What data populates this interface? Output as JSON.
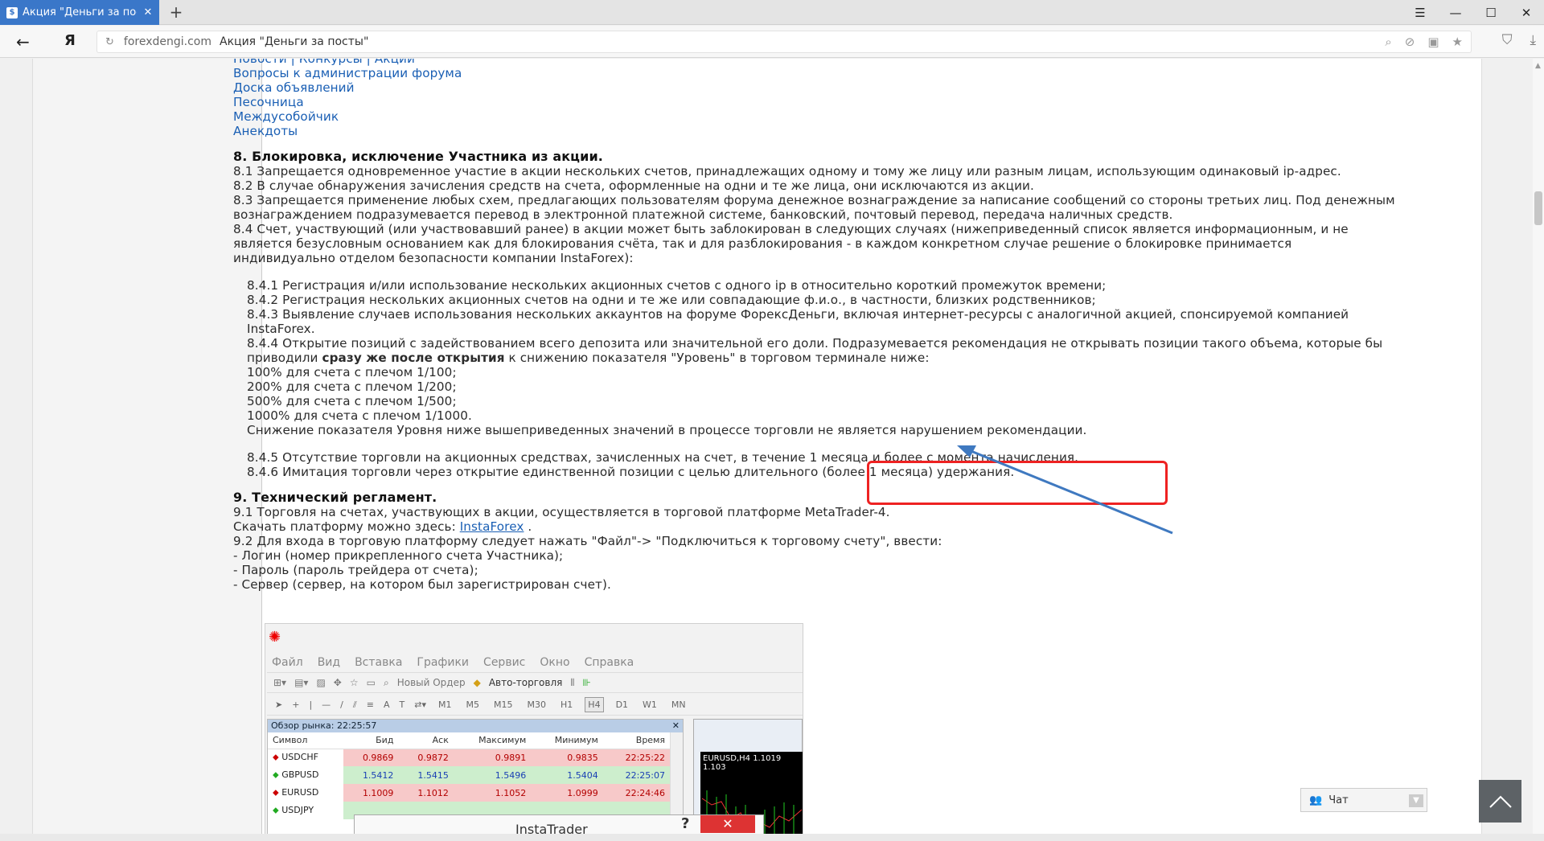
{
  "browser": {
    "tab_title": "Акция \"Деньги за посты\"",
    "tab_favicon": "forum-favicon",
    "new_tab": "+",
    "domain": "forexdengi.com",
    "page_title": "Акция \"Деньги за посты\"",
    "yandex_logo": "Я"
  },
  "content": {
    "links": [
      "Новости | Конкурсы | Акции",
      "Вопросы к администрации форума",
      "Доска объявлений",
      "Песочница",
      "Междусобойчик",
      "Анекдоты"
    ],
    "section8_title": "8. Блокировка, исключение Участника из акции.",
    "s8_1": "8.1 Запрещается одновременное участие в акции нескольких счетов, принадлежащих одному и тому же лицу или разным лицам, использующим одинаковый ip-адрес.",
    "s8_2": "8.2 В случае обнаружения зачисления средств на счета, оформленные на одни и те же лица, они исключаются из акции.",
    "s8_3a": "8.3 Запрещается применение любых схем, предлагающих пользователям форума денежное вознаграждение за написание сообщений со стороны третьих лиц. Под денежным",
    "s8_3b": "вознаграждением подразумевается перевод в электронной платежной системе, банковский, почтовый перевод, передача наличных средств.",
    "s8_4a": "8.4 Счет, участвующий (или участвовавший ранее) в акции может быть заблокирован в следующих случаях (нижеприведенный список является информационным, и не",
    "s8_4b": "является безусловным основанием как для блокирования счёта, так и для разблокирования - в каждом конкретном случае решение о блокировке принимается",
    "s8_4c": "индивидуально отделом безопасности компании InstaForex):",
    "s8_4_1": "8.4.1 Регистрация и/или использование нескольких акционных счетов с одного ip в относительно короткий промежуток времени;",
    "s8_4_2": "8.4.2 Регистрация нескольких акционных счетов на одни и те же или совпадающие ф.и.о., в частности, близких родственников;",
    "s8_4_3a": "8.4.3 Выявление случаев использования нескольких аккаунтов на форуме ФорексДеньги, включая интернет-ресурсы с аналогичной акцией, спонсируемой компанией",
    "s8_4_3b": "InstaForex.",
    "s8_4_4a": "8.4.4 Открытие позиций с задействованием всего депозита или значительной его доли. Подразумевается рекомендация не открывать позиции такого объема, которые бы",
    "s8_4_4b_pre": "приводили ",
    "s8_4_4b_bold": "сразу же после открытия",
    "s8_4_4b_post": " к снижению показателя \"Уровень\" в торговом терминале ниже:",
    "lev1": "100% для счета с плечом 1/100;",
    "lev2": "200% для счета с плечом 1/200;",
    "lev3": "500% для счета с плечом 1/500;",
    "lev4": "1000% для счета с плечом 1/1000.",
    "lev_note": "Снижение показателя Уровня ниже вышеприведенных значений в процессе торговли не является нарушением рекомендации.",
    "s8_4_5": "8.4.5 Отсутствие торговли на акционных средствах, зачисленных на счет, в течение 1 месяца и более с момента начисления.",
    "s8_4_6": "8.4.6 Имитация торговли через открытие единственной позиции с целью длительного (более 1 месяца) удержания.",
    "section9_title": "9. Технический регламент.",
    "s9_1": "9.1 Торговля на счетах, участвующих в акции, осуществляется в торговой платформе MetaTrader-4.",
    "s9_dl_pre": "Скачать платформу можно здесь: ",
    "s9_dl_link": "InstaForex",
    "s9_dl_post": " .",
    "s9_2": "9.2 Для входа в торговую платформу следует нажать \"Файл\"-> \"Подключиться к торговому счету\", ввести:",
    "s9_login": "- Логин (номер прикрепленного счета Участника);",
    "s9_pass": "- Пароль (пароль трейдера от счета);",
    "s9_server": "- Сервер (сервер, на котором был зарегистрирован счет)."
  },
  "mt4": {
    "menu": [
      "Файл",
      "Вид",
      "Вставка",
      "Графики",
      "Сервис",
      "Окно",
      "Справка"
    ],
    "new_order": "Новый Ордер",
    "auto_trading": "Авто-торговля",
    "timeframes": [
      "M1",
      "M5",
      "M15",
      "M30",
      "H1",
      "H4",
      "D1",
      "W1",
      "MN"
    ],
    "active_tf": "H4",
    "market_watch_title": "Обзор рынка: 22:25:57",
    "columns": [
      "Символ",
      "Бид",
      "Аск",
      "Максимум",
      "Минимум",
      "Время"
    ],
    "rows": [
      {
        "symbol": "USDCHF",
        "dir": "dn",
        "bid": "0.9869",
        "ask": "0.9872",
        "high": "0.9891",
        "low": "0.9835",
        "time": "22:25:22"
      },
      {
        "symbol": "GBPUSD",
        "dir": "up",
        "bid": "1.5412",
        "ask": "1.5415",
        "high": "1.5496",
        "low": "1.5404",
        "time": "22:25:07"
      },
      {
        "symbol": "EURUSD",
        "dir": "dn",
        "bid": "1.1009",
        "ask": "1.1012",
        "high": "1.1052",
        "low": "1.0999",
        "time": "22:24:46"
      },
      {
        "symbol": "USDJPY",
        "dir": "up",
        "bid": "",
        "ask": "",
        "high": "",
        "low": "",
        "time": ""
      }
    ],
    "chart_label": "EURUSD,H4  1.1019 1.103",
    "dialog_title": "InstaTrader",
    "dialog_help": "?",
    "dialog_close": "✕"
  },
  "widgets": {
    "chat_label": "Чат"
  },
  "colors": {
    "link": "#1a5fb4",
    "highlight_box": "#e22222",
    "arrow": "#3f79c0",
    "tab_active": "#3a77c9"
  }
}
